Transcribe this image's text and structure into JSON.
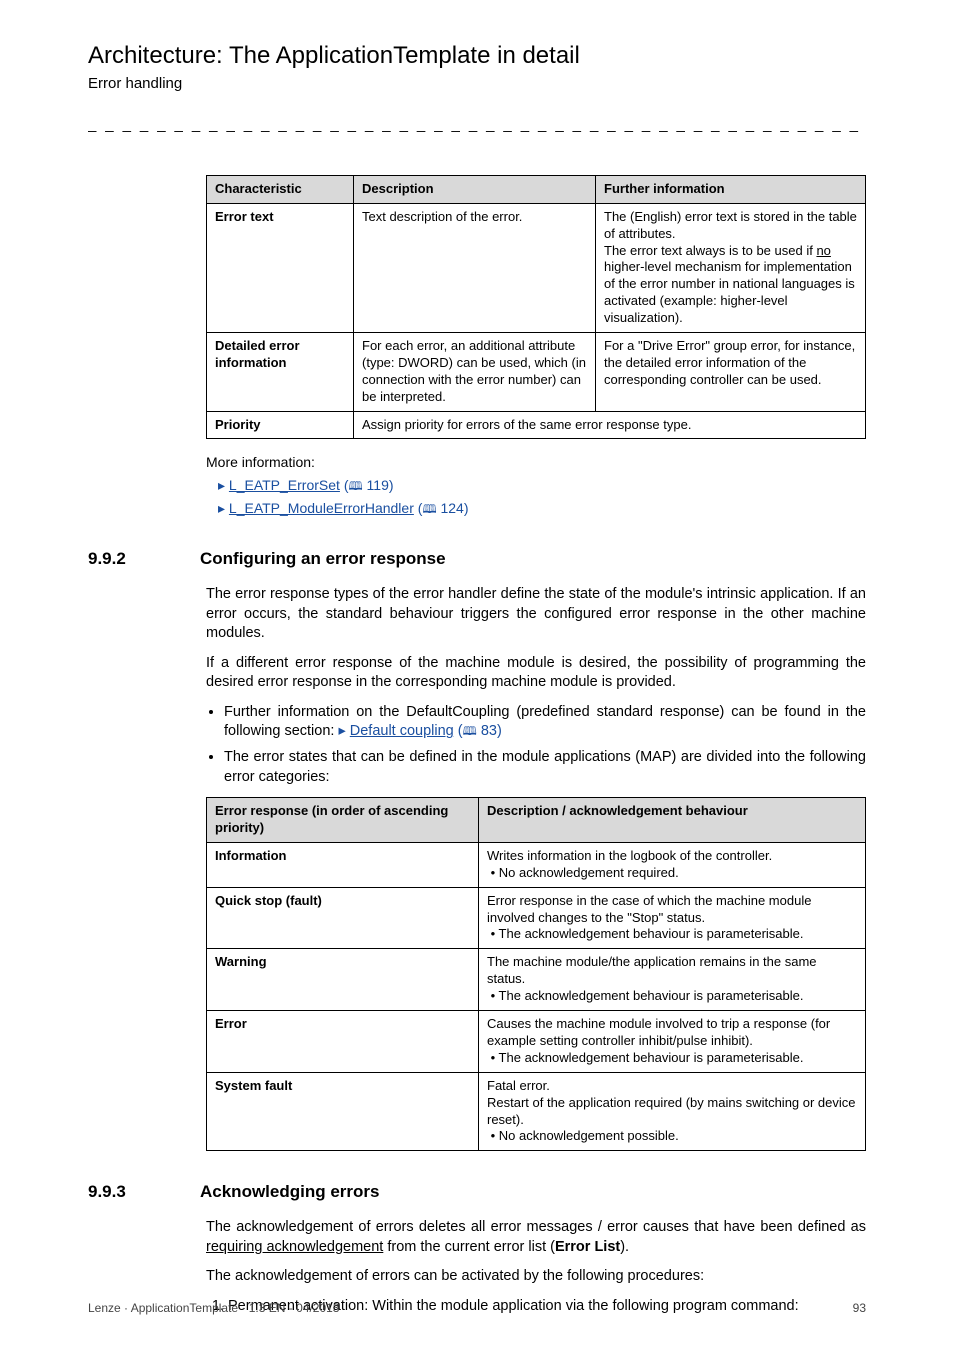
{
  "running": {
    "title": "Architecture: The ApplicationTemplate in detail",
    "subtitle": "Error handling"
  },
  "table1": {
    "headers": [
      "Characteristic",
      "Description",
      "Further information"
    ],
    "rows": [
      {
        "c": "Error text",
        "d": "Text description of the error.",
        "f_line1": "The (English) error text is stored in the table of attributes.",
        "f_line2a": "The error text always is to be used if ",
        "f_line2_no": "no",
        "f_line2b": " higher-level mechanism for implementation of the error number in national languages is activated (example: higher-level visualization)."
      },
      {
        "c": "Detailed error information",
        "d": "For each error, an additional attribute (type: DWORD) can be used, which (in connection with the error number) can be interpreted.",
        "f": "For a \"Drive Error\" group error, for instance, the detailed error information of the corresponding controller can be used."
      },
      {
        "c": "Priority",
        "d_span": "Assign priority for errors of the same error response type."
      }
    ]
  },
  "more_info_label": "More information:",
  "links": [
    {
      "arrow": "▸",
      "text": "L_EATP_ErrorSet",
      "page_icon": "🕮",
      "page": "119"
    },
    {
      "arrow": "▸",
      "text": "L_EATP_ModuleErrorHandler",
      "page_icon": "🕮",
      "page": "124"
    }
  ],
  "section_992": {
    "num": "9.9.2",
    "title": "Configuring an error response",
    "p1": "The error response types of the error handler define the state of the module's intrinsic application. If an error occurs, the standard behaviour triggers the configured error response in the other machine modules.",
    "p2": "If a different error response of the machine module is desired, the possibility of programming the desired error response in the corresponding machine module is provided.",
    "b1a": "Further information on the DefaultCoupling (predefined standard response) can be found in the following section:  ",
    "b1_arrow": "▸",
    "b1_link": "Default coupling",
    "b1_icon": "🕮",
    "b1_page": "83",
    "b2": "The error states that can be defined in the module applications (MAP) are divided into the following error categories:"
  },
  "table2": {
    "headers": [
      "Error response (in order of ascending priority)",
      "Description / acknowledgement behaviour"
    ],
    "rows": [
      {
        "r": "Information",
        "d1": "Writes information in the logbook of the controller.",
        "d2": "• No acknowledgement required."
      },
      {
        "r": "Quick stop (fault)",
        "d1": "Error response in the case of which the machine module involved changes to the \"Stop\" status.",
        "d2": "• The acknowledgement behaviour is parameterisable."
      },
      {
        "r": "Warning",
        "d1": "The machine module/the application remains in the same status.",
        "d2": "• The acknowledgement behaviour is parameterisable."
      },
      {
        "r": "Error",
        "d1": "Causes the machine module involved to trip a response (for example setting controller inhibit/pulse inhibit).",
        "d2": "• The acknowledgement behaviour is parameterisable."
      },
      {
        "r": "System fault",
        "d1": "Fatal error.",
        "d2": "Restart of the application required (by mains switching or device reset).",
        "d3": "• No acknowledgement possible."
      }
    ]
  },
  "section_993": {
    "num": "9.9.3",
    "title": "Acknowledging errors",
    "p1a": "The acknowledgement of errors deletes all error messages / error causes that have been defined as ",
    "p1_req": "requiring acknowledgement",
    "p1b": " from the current error list (",
    "p1_bold": "Error List",
    "p1c": ").",
    "p2": "The acknowledgement of errors can be activated by the following procedures:",
    "ol1": "Permanent activation: Within the module application via the following program command:"
  },
  "footer": {
    "left": "Lenze · ApplicationTemplate · 1.3 EN - 04/2013",
    "right": "93"
  }
}
